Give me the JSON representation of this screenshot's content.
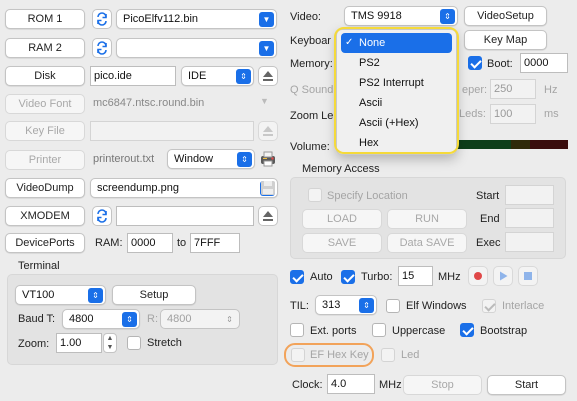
{
  "left": {
    "rom1": {
      "label": "ROM 1",
      "file": "PicoElfv112.bin"
    },
    "ram2": {
      "label": "RAM 2",
      "file": ""
    },
    "disk": {
      "label": "Disk",
      "file": "pico.ide",
      "type": "IDE"
    },
    "video_font": {
      "label": "Video Font",
      "file": "mc6847.ntsc.round.bin"
    },
    "key_file": {
      "label": "Key File",
      "file": ""
    },
    "printer": {
      "label": "Printer",
      "file": "printerout.txt",
      "mode": "Window"
    },
    "video_dump": {
      "label": "VideoDump",
      "file": "screendump.png"
    },
    "xmodem": {
      "label": "XMODEM",
      "file": ""
    },
    "device_ports": {
      "label": "DevicePorts",
      "ram_label": "RAM:",
      "ram_from": "0000",
      "to_label": "to",
      "ram_to": "7FFF"
    }
  },
  "terminal": {
    "title": "Terminal",
    "type": "VT100",
    "setup_label": "Setup",
    "baud_t_label": "Baud T:",
    "baud_t": "4800",
    "baud_r_label": "R:",
    "baud_r": "4800",
    "zoom_label": "Zoom:",
    "zoom": "1.00",
    "stretch_label": "Stretch"
  },
  "right": {
    "video_label": "Video:",
    "video_value": "TMS 9918",
    "video_setup_label": "VideoSetup",
    "keyboard_label": "Keyboar",
    "key_map_label": "Key Map",
    "memory_label": "Memory:",
    "boot_label": "Boot:",
    "boot_value": "0000",
    "q_sound_label": "Q Sound",
    "beeper_label": "eper:",
    "beeper_value": "250",
    "hz_label": "Hz",
    "zoom_le_label": "Zoom Le",
    "leds_label": "Leds:",
    "leds_value": "100",
    "ms_label": "ms",
    "volume_label": "Volume:"
  },
  "keyboard_menu": {
    "options": [
      "None",
      "PS2",
      "PS2 Interrupt",
      "Ascii",
      "Ascii (+Hex)",
      "Hex"
    ],
    "selected": "None",
    "check_mark": "✓"
  },
  "memory_access": {
    "title": "Memory Access",
    "specify_location_label": "Specify Location",
    "start_label": "Start",
    "end_label": "End",
    "exec_label": "Exec",
    "load_label": "LOAD",
    "run_label": "RUN",
    "save_label": "SAVE",
    "data_save_label": "Data SAVE"
  },
  "controls": {
    "auto_label": "Auto",
    "turbo_label": "Turbo:",
    "turbo_value": "15",
    "mhz_label": "MHz",
    "til_label": "TIL:",
    "til_value": "313",
    "elf_windows_label": "Elf Windows",
    "interlace_label": "Interlace",
    "ext_ports_label": "Ext. ports",
    "uppercase_label": "Uppercase",
    "bootstrap_label": "Bootstrap",
    "ef_hex_key_label": "EF Hex Key",
    "led_label": "Led",
    "clock_label": "Clock:",
    "clock_value": "4.0",
    "clock_mhz_label": "MHz",
    "stop_label": "Stop",
    "start_label": "Start"
  },
  "colors": {
    "accent": "#1a6fe8",
    "highlight_yellow": "#f5da3a",
    "highlight_orange": "#f2a35a",
    "record_red": "#e04848"
  }
}
